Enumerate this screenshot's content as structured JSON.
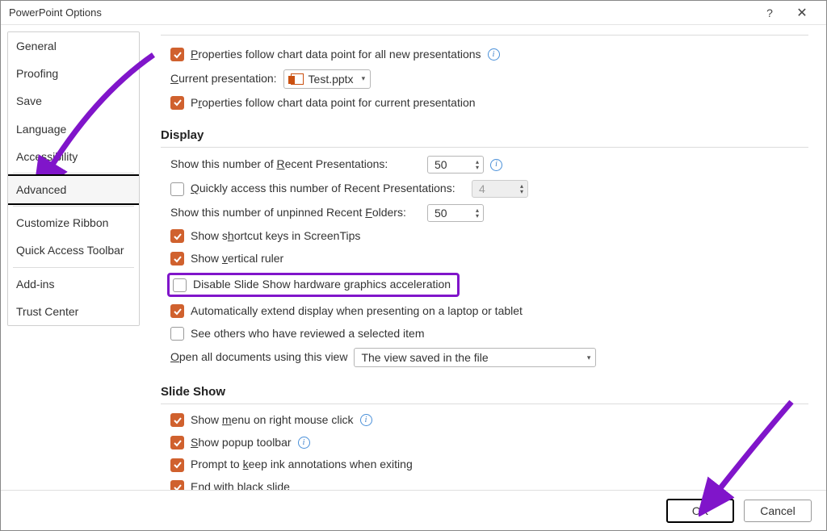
{
  "window": {
    "title": "PowerPoint Options"
  },
  "sidebar": {
    "items": [
      {
        "label": "General"
      },
      {
        "label": "Proofing"
      },
      {
        "label": "Save"
      },
      {
        "label": "Language"
      },
      {
        "label": "Accessibility"
      },
      {
        "label": "Advanced",
        "selected": true
      },
      {
        "label": "Customize Ribbon"
      },
      {
        "label": "Quick Access Toolbar"
      },
      {
        "label": "Add-ins"
      },
      {
        "label": "Trust Center"
      }
    ]
  },
  "chart_section": {
    "prop_all": "Properties follow chart data point for all new presentations",
    "current_label": "Current presentation:",
    "current_file": "Test.pptx",
    "prop_current": "Properties follow chart data point for current presentation"
  },
  "display": {
    "header": "Display",
    "recent_presentations_label": "Show this number of Recent Presentations:",
    "recent_presentations_value": "50",
    "quick_access_label": "Quickly access this number of Recent Presentations:",
    "quick_access_value": "4",
    "recent_folders_label": "Show this number of unpinned Recent Folders:",
    "recent_folders_value": "50",
    "shortcut_screentips": "Show shortcut keys in ScreenTips",
    "vertical_ruler": "Show vertical ruler",
    "disable_hw_accel": "Disable Slide Show hardware graphics acceleration",
    "auto_extend": "Automatically extend display when presenting on a laptop or tablet",
    "see_others": "See others who have reviewed a selected item",
    "open_view_label": "Open all documents using this view",
    "open_view_value": "The view saved in the file"
  },
  "slideshow": {
    "header": "Slide Show",
    "menu_right_click": "Show menu on right mouse click",
    "popup_toolbar": "Show popup toolbar",
    "prompt_ink": "Prompt to keep ink annotations when exiting",
    "end_black": "End with black slide"
  },
  "footer": {
    "ok": "OK",
    "cancel": "Cancel"
  }
}
